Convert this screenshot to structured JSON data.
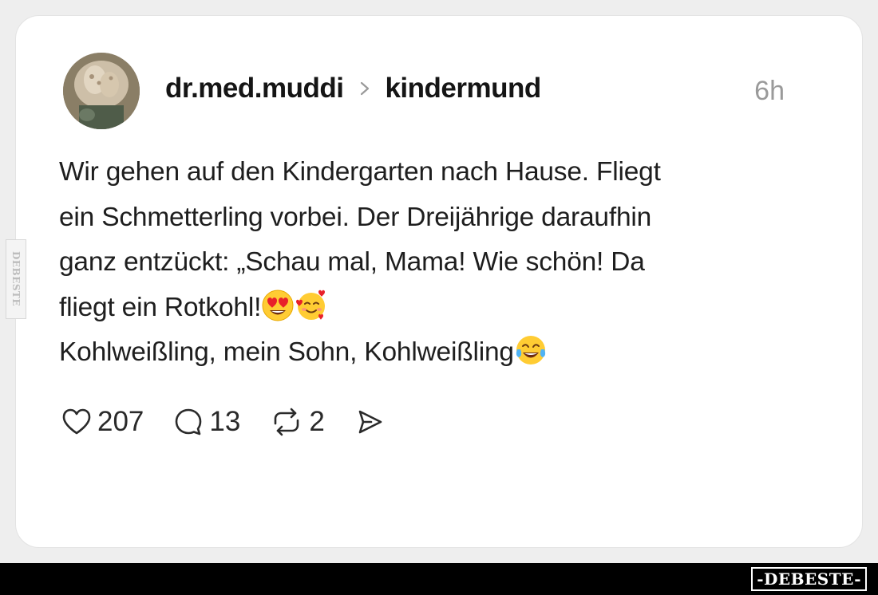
{
  "post": {
    "username": "dr.med.muddi",
    "community": "kindermund",
    "timestamp": "6h",
    "lines": [
      "Wir gehen auf den Kindergarten nach Hause. Fliegt",
      "ein Schmetterling vorbei. Der Dreijährige daraufhin",
      "ganz entzückt: „Schau mal, Mama! Wie schön! Da",
      "fliegt ein Rotkohl!",
      "Kohlweißling, mein Sohn, Kohlweißling"
    ],
    "emojis": [
      "heart-eyes-emoji",
      "smiling-hearts-emoji",
      "tears-of-joy-emoji"
    ]
  },
  "actions": {
    "likes": "207",
    "comments": "13",
    "reposts": "2"
  },
  "icons": [
    "heart-icon",
    "comment-icon",
    "repost-icon",
    "share-icon",
    "chevron-right-icon"
  ],
  "watermark": {
    "bottom": "-DEBESTE-",
    "side": "DEBESTE"
  },
  "colors": {
    "background": "#eeeeee",
    "card": "#ffffff",
    "text": "#1c1c1c",
    "muted": "#9a9a9a",
    "footer": "#000000"
  }
}
